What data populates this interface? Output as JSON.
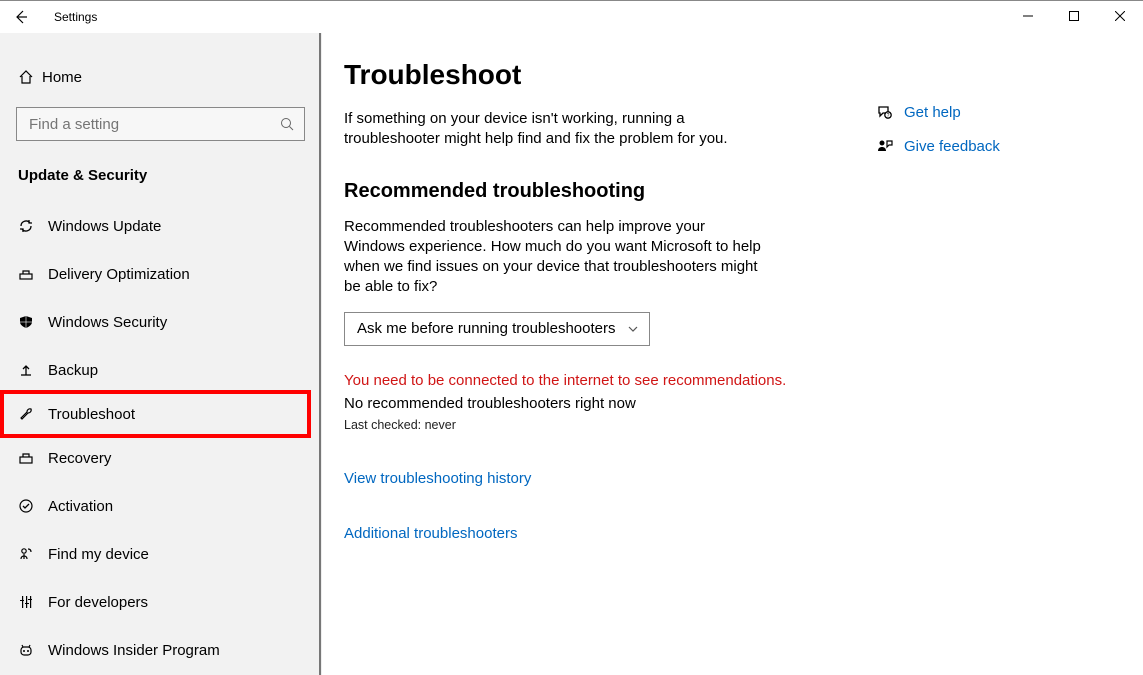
{
  "window": {
    "title": "Settings"
  },
  "sidebar": {
    "home": "Home",
    "search_placeholder": "Find a setting",
    "category": "Update & Security",
    "items": [
      {
        "icon": "sync-icon",
        "label": "Windows Update"
      },
      {
        "icon": "delivery-icon",
        "label": "Delivery Optimization"
      },
      {
        "icon": "shield-icon",
        "label": "Windows Security"
      },
      {
        "icon": "backup-icon",
        "label": "Backup"
      },
      {
        "icon": "wrench-icon",
        "label": "Troubleshoot",
        "selected": true
      },
      {
        "icon": "recovery-icon",
        "label": "Recovery"
      },
      {
        "icon": "check-icon",
        "label": "Activation"
      },
      {
        "icon": "find-device-icon",
        "label": "Find my device"
      },
      {
        "icon": "developer-icon",
        "label": "For developers"
      },
      {
        "icon": "insider-icon",
        "label": "Windows Insider Program"
      }
    ]
  },
  "main": {
    "title": "Troubleshoot",
    "intro": "If something on your device isn't working, running a troubleshooter might help find and fix the problem for you.",
    "rec_title": "Recommended troubleshooting",
    "rec_text": "Recommended troubleshooters can help improve your Windows experience. How much do you want Microsoft to help when we find issues on your device that troubleshooters might be able to fix?",
    "dropdown_value": "Ask me before running troubleshooters",
    "warning": "You need to be connected to the internet to see recommendations.",
    "no_rec": "No recommended troubleshooters right now",
    "last_checked": "Last checked: never",
    "history_link": "View troubleshooting history",
    "additional_link": "Additional troubleshooters"
  },
  "aside": {
    "help": "Get help",
    "feedback": "Give feedback"
  }
}
